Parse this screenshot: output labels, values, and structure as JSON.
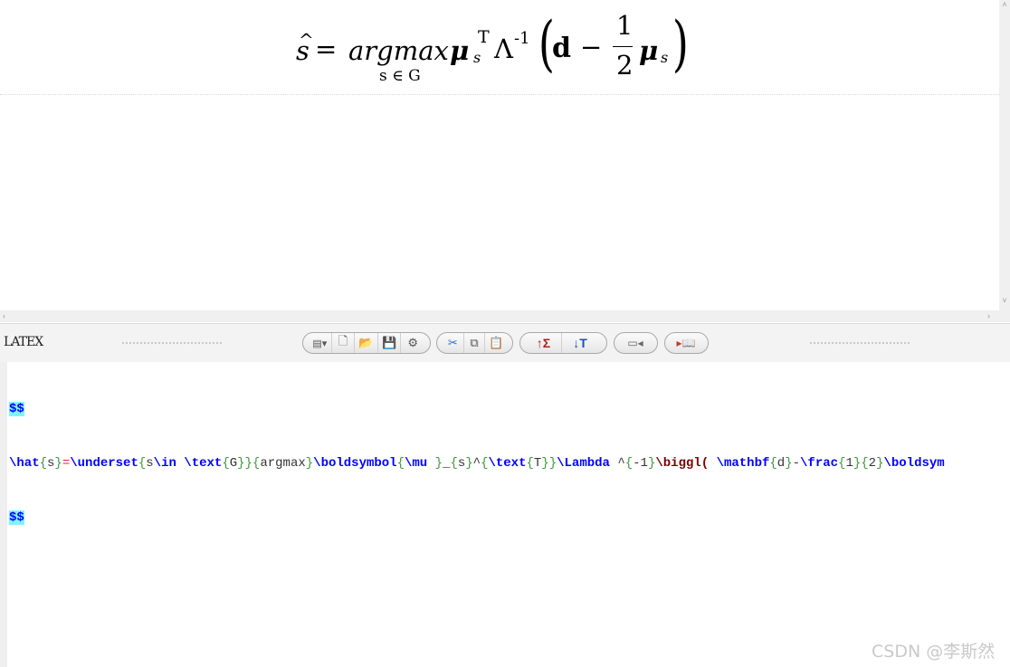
{
  "formula": {
    "hat": "^",
    "s": "s",
    "equals": "=",
    "argmax": "argmax",
    "mu": "μ",
    "sub_s": "s",
    "sup_T": "T",
    "lambda": "Λ",
    "sup_neg1": "-1",
    "lparen": "(",
    "d": "d",
    "minus": "−",
    "frac_num": "1",
    "frac_den": "2",
    "mu2": "μ",
    "sub_s2": "s",
    "rparen": ")",
    "under": "s ∈ G"
  },
  "toolbar": {
    "logo": "LATEX"
  },
  "icons": {
    "view": "▤▾",
    "new": "🗋",
    "open": "📂",
    "save": "💾",
    "settings": "⚙",
    "cut": "✂",
    "copy": "⧉",
    "paste": "📋",
    "export_up": "↑Σ",
    "import_down": "↓T",
    "panel": "▭◂",
    "book": "▸📖"
  },
  "editor": {
    "line1": "$$",
    "line2_tokens": [
      {
        "t": "\\hat",
        "c": "kw"
      },
      {
        "t": "{",
        "c": "br"
      },
      {
        "t": "s",
        "c": "ar"
      },
      {
        "t": "}",
        "c": "br"
      },
      {
        "t": "=",
        "c": "eq"
      },
      {
        "t": "\\underset",
        "c": "kw"
      },
      {
        "t": "{",
        "c": "br"
      },
      {
        "t": "s",
        "c": "ar"
      },
      {
        "t": "\\in",
        "c": "kw"
      },
      {
        "t": " ",
        "c": "ar"
      },
      {
        "t": "\\text",
        "c": "kw"
      },
      {
        "t": "{",
        "c": "br"
      },
      {
        "t": "G",
        "c": "ar"
      },
      {
        "t": "}}{",
        "c": "br"
      },
      {
        "t": "argmax",
        "c": "ar"
      },
      {
        "t": "}",
        "c": "br"
      },
      {
        "t": "\\boldsymbol",
        "c": "kw"
      },
      {
        "t": "{",
        "c": "br"
      },
      {
        "t": "\\mu",
        "c": "kw"
      },
      {
        "t": " ",
        "c": "ar"
      },
      {
        "t": "}",
        "c": "br"
      },
      {
        "t": "_",
        "c": "ar"
      },
      {
        "t": "{",
        "c": "br"
      },
      {
        "t": "s",
        "c": "ar"
      },
      {
        "t": "}",
        "c": "br"
      },
      {
        "t": "^",
        "c": "ar"
      },
      {
        "t": "{",
        "c": "br"
      },
      {
        "t": "\\text",
        "c": "kw"
      },
      {
        "t": "{",
        "c": "br"
      },
      {
        "t": "T",
        "c": "ar"
      },
      {
        "t": "}}",
        "c": "br"
      },
      {
        "t": "\\Lambda",
        "c": "kw"
      },
      {
        "t": " ^",
        "c": "ar"
      },
      {
        "t": "{",
        "c": "br"
      },
      {
        "t": "-1",
        "c": "ar"
      },
      {
        "t": "}",
        "c": "br"
      },
      {
        "t": "\\biggl(",
        "c": "kr"
      },
      {
        "t": " ",
        "c": "ar"
      },
      {
        "t": "\\mathbf",
        "c": "kw"
      },
      {
        "t": "{",
        "c": "br"
      },
      {
        "t": "d",
        "c": "ar"
      },
      {
        "t": "}",
        "c": "br"
      },
      {
        "t": "-",
        "c": "ar"
      },
      {
        "t": "\\frac",
        "c": "kw"
      },
      {
        "t": "{",
        "c": "br"
      },
      {
        "t": "1",
        "c": "ar"
      },
      {
        "t": "}{",
        "c": "br"
      },
      {
        "t": "2",
        "c": "ar"
      },
      {
        "t": "}",
        "c": "br"
      },
      {
        "t": "\\boldsym",
        "c": "kw"
      }
    ],
    "line3": "$$"
  },
  "watermark": "CSDN @李斯然"
}
